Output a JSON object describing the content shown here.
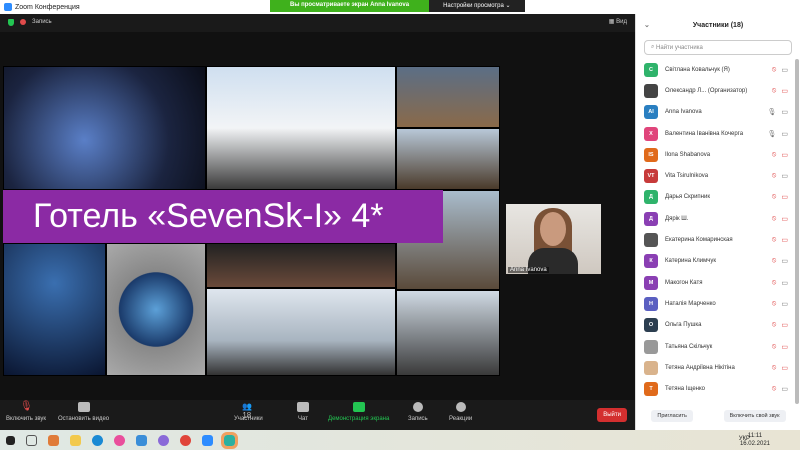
{
  "window": {
    "title": "Zoom Конференция"
  },
  "share_banner": {
    "status": "Вы просматриваете экран Anna Ivanova",
    "settings": "Настройки просмотра ⌄"
  },
  "topbar": {
    "record": "Запись",
    "view": "Вид"
  },
  "slide": {
    "title": "Готель «SevenSk-I» 4*"
  },
  "video": {
    "name": "Anna Ivanova"
  },
  "toolbar": {
    "audio": "Включить звук",
    "video": "Остановить видео",
    "participants": "Участники",
    "participants_count": "18",
    "chat": "Чат",
    "share": "Демонстрация экрана",
    "record": "Запись",
    "reactions": "Реакции",
    "leave": "Выйти"
  },
  "panel": {
    "title": "Участники (18)",
    "search_placeholder": "Найти участника",
    "invite": "Пригласить",
    "unmute_self": "Включить свой звук",
    "participants": [
      {
        "initials": "С",
        "name": "Світлана Ковальчук (Я)",
        "color": "#2fb36b",
        "mic": "off",
        "video": "on"
      },
      {
        "initials": "",
        "name": "Олександр Л... (Организатор)",
        "color": "#444",
        "mic": "off",
        "video": "off"
      },
      {
        "initials": "AI",
        "name": "Anna Ivanova",
        "color": "#2a7fc1",
        "mic": "on",
        "video": "on"
      },
      {
        "initials": "Х",
        "name": "Валентина Іванівна Кочерга",
        "color": "#e0457b",
        "mic": "on",
        "video": "on"
      },
      {
        "initials": "IS",
        "name": "Ilona Shabanova",
        "color": "#e06a1b",
        "mic": "off",
        "video": "off"
      },
      {
        "initials": "VT",
        "name": "Vita Tsirulnikova",
        "color": "#c73a3a",
        "mic": "off",
        "video": "on"
      },
      {
        "initials": "Д",
        "name": "Дарья Скрипник",
        "color": "#2fb36b",
        "mic": "off",
        "video": "off"
      },
      {
        "initials": "Д",
        "name": "Дярік Ш.",
        "color": "#8a3fb3",
        "mic": "off",
        "video": "off"
      },
      {
        "initials": "",
        "name": "Екатерина Комаринская",
        "color": "#555",
        "mic": "off",
        "video": "off"
      },
      {
        "initials": "К",
        "name": "Катерина Климчук",
        "color": "#8a3fb3",
        "mic": "off",
        "video": "on"
      },
      {
        "initials": "М",
        "name": "Макогон Катя",
        "color": "#8a3fb3",
        "mic": "off",
        "video": "on"
      },
      {
        "initials": "Н",
        "name": "Наталія Марченко",
        "color": "#5a5fc1",
        "mic": "off",
        "video": "on"
      },
      {
        "initials": "О",
        "name": "Ольга Пушка",
        "color": "#2c3e50",
        "mic": "off",
        "video": "off"
      },
      {
        "initials": "",
        "name": "Татьяна Скільчук",
        "color": "#999",
        "mic": "off",
        "video": "off"
      },
      {
        "initials": "",
        "name": "Тетяна Андріївна Нікітіна",
        "color": "#d9b38c",
        "mic": "off",
        "video": "off"
      },
      {
        "initials": "Т",
        "name": "Тетяна Іщенко",
        "color": "#e06a1b",
        "mic": "off",
        "video": "on"
      }
    ]
  },
  "taskbar": {
    "lang": "УКР",
    "time": "11:11",
    "date": "16.02.2021"
  }
}
